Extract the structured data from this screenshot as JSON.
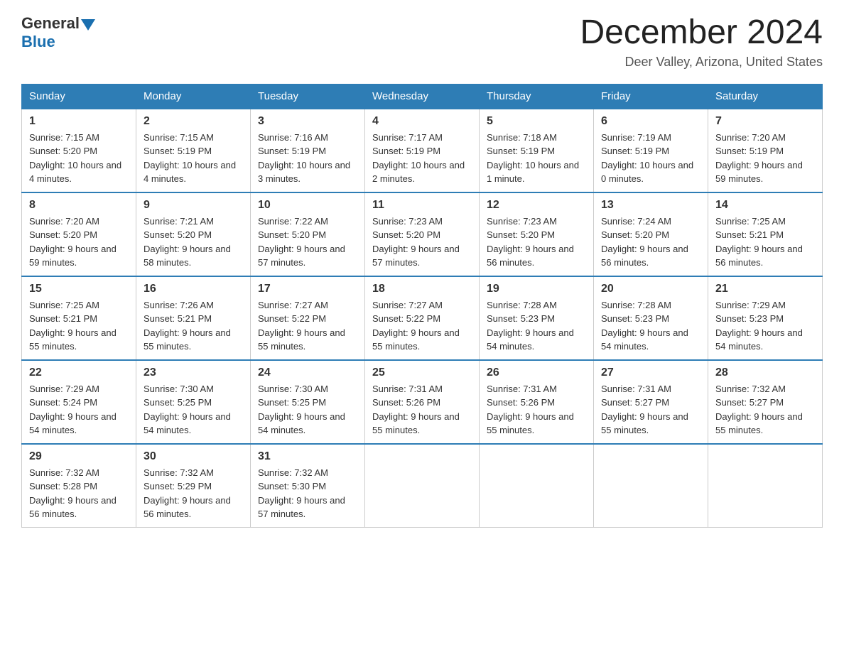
{
  "logo": {
    "general": "General",
    "blue": "Blue"
  },
  "header": {
    "title": "December 2024",
    "location": "Deer Valley, Arizona, United States"
  },
  "days_of_week": [
    "Sunday",
    "Monday",
    "Tuesday",
    "Wednesday",
    "Thursday",
    "Friday",
    "Saturday"
  ],
  "weeks": [
    [
      {
        "day": "1",
        "sunrise": "7:15 AM",
        "sunset": "5:20 PM",
        "daylight": "10 hours and 4 minutes."
      },
      {
        "day": "2",
        "sunrise": "7:15 AM",
        "sunset": "5:19 PM",
        "daylight": "10 hours and 4 minutes."
      },
      {
        "day": "3",
        "sunrise": "7:16 AM",
        "sunset": "5:19 PM",
        "daylight": "10 hours and 3 minutes."
      },
      {
        "day": "4",
        "sunrise": "7:17 AM",
        "sunset": "5:19 PM",
        "daylight": "10 hours and 2 minutes."
      },
      {
        "day": "5",
        "sunrise": "7:18 AM",
        "sunset": "5:19 PM",
        "daylight": "10 hours and 1 minute."
      },
      {
        "day": "6",
        "sunrise": "7:19 AM",
        "sunset": "5:19 PM",
        "daylight": "10 hours and 0 minutes."
      },
      {
        "day": "7",
        "sunrise": "7:20 AM",
        "sunset": "5:19 PM",
        "daylight": "9 hours and 59 minutes."
      }
    ],
    [
      {
        "day": "8",
        "sunrise": "7:20 AM",
        "sunset": "5:20 PM",
        "daylight": "9 hours and 59 minutes."
      },
      {
        "day": "9",
        "sunrise": "7:21 AM",
        "sunset": "5:20 PM",
        "daylight": "9 hours and 58 minutes."
      },
      {
        "day": "10",
        "sunrise": "7:22 AM",
        "sunset": "5:20 PM",
        "daylight": "9 hours and 57 minutes."
      },
      {
        "day": "11",
        "sunrise": "7:23 AM",
        "sunset": "5:20 PM",
        "daylight": "9 hours and 57 minutes."
      },
      {
        "day": "12",
        "sunrise": "7:23 AM",
        "sunset": "5:20 PM",
        "daylight": "9 hours and 56 minutes."
      },
      {
        "day": "13",
        "sunrise": "7:24 AM",
        "sunset": "5:20 PM",
        "daylight": "9 hours and 56 minutes."
      },
      {
        "day": "14",
        "sunrise": "7:25 AM",
        "sunset": "5:21 PM",
        "daylight": "9 hours and 56 minutes."
      }
    ],
    [
      {
        "day": "15",
        "sunrise": "7:25 AM",
        "sunset": "5:21 PM",
        "daylight": "9 hours and 55 minutes."
      },
      {
        "day": "16",
        "sunrise": "7:26 AM",
        "sunset": "5:21 PM",
        "daylight": "9 hours and 55 minutes."
      },
      {
        "day": "17",
        "sunrise": "7:27 AM",
        "sunset": "5:22 PM",
        "daylight": "9 hours and 55 minutes."
      },
      {
        "day": "18",
        "sunrise": "7:27 AM",
        "sunset": "5:22 PM",
        "daylight": "9 hours and 55 minutes."
      },
      {
        "day": "19",
        "sunrise": "7:28 AM",
        "sunset": "5:23 PM",
        "daylight": "9 hours and 54 minutes."
      },
      {
        "day": "20",
        "sunrise": "7:28 AM",
        "sunset": "5:23 PM",
        "daylight": "9 hours and 54 minutes."
      },
      {
        "day": "21",
        "sunrise": "7:29 AM",
        "sunset": "5:23 PM",
        "daylight": "9 hours and 54 minutes."
      }
    ],
    [
      {
        "day": "22",
        "sunrise": "7:29 AM",
        "sunset": "5:24 PM",
        "daylight": "9 hours and 54 minutes."
      },
      {
        "day": "23",
        "sunrise": "7:30 AM",
        "sunset": "5:25 PM",
        "daylight": "9 hours and 54 minutes."
      },
      {
        "day": "24",
        "sunrise": "7:30 AM",
        "sunset": "5:25 PM",
        "daylight": "9 hours and 54 minutes."
      },
      {
        "day": "25",
        "sunrise": "7:31 AM",
        "sunset": "5:26 PM",
        "daylight": "9 hours and 55 minutes."
      },
      {
        "day": "26",
        "sunrise": "7:31 AM",
        "sunset": "5:26 PM",
        "daylight": "9 hours and 55 minutes."
      },
      {
        "day": "27",
        "sunrise": "7:31 AM",
        "sunset": "5:27 PM",
        "daylight": "9 hours and 55 minutes."
      },
      {
        "day": "28",
        "sunrise": "7:32 AM",
        "sunset": "5:27 PM",
        "daylight": "9 hours and 55 minutes."
      }
    ],
    [
      {
        "day": "29",
        "sunrise": "7:32 AM",
        "sunset": "5:28 PM",
        "daylight": "9 hours and 56 minutes."
      },
      {
        "day": "30",
        "sunrise": "7:32 AM",
        "sunset": "5:29 PM",
        "daylight": "9 hours and 56 minutes."
      },
      {
        "day": "31",
        "sunrise": "7:32 AM",
        "sunset": "5:30 PM",
        "daylight": "9 hours and 57 minutes."
      },
      null,
      null,
      null,
      null
    ]
  ],
  "labels": {
    "sunrise_prefix": "Sunrise: ",
    "sunset_prefix": "Sunset: ",
    "daylight_prefix": "Daylight: "
  }
}
